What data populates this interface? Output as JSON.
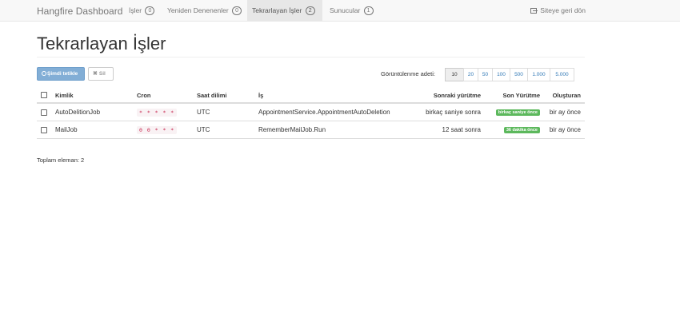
{
  "navbar": {
    "brand": "Hangfire Dashboard",
    "items": [
      {
        "label": "İşler",
        "count": "0"
      },
      {
        "label": "Yeniden Denenenler",
        "count": "0"
      },
      {
        "label": "Tekrarlayan İşler",
        "count": "2",
        "active": true
      },
      {
        "label": "Sunucular",
        "count": "1"
      }
    ],
    "back_label": "Siteye geri dön"
  },
  "page": {
    "title": "Tekrarlayan İşler"
  },
  "toolbar": {
    "trigger_label": "Şimdi tetikle",
    "delete_label": "Sil",
    "page_size_label": "Görüntülenme adeti:",
    "page_sizes": [
      "10",
      "20",
      "50",
      "100",
      "500",
      "1.000",
      "5.000"
    ],
    "selected_page_size": "10"
  },
  "table": {
    "columns": [
      "Kimlik",
      "Cron",
      "Saat dilimi",
      "İş",
      "Sonraki yürütme",
      "Son Yürütme",
      "Oluşturan"
    ],
    "rows": [
      {
        "id": "AutoDelitionJob",
        "cron": "* * * * *",
        "timezone": "UTC",
        "job": "AppointmentService.AppointmentAutoDeletion",
        "next": "birkaç saniye sonra",
        "last": "birkaç saniye önce",
        "created": "bir ay önce"
      },
      {
        "id": "MailJob",
        "cron": "0 0 * * *",
        "timezone": "UTC",
        "job": "RememberMailJob.Run",
        "next": "12 saat sonra",
        "last": "36 dakika önce",
        "created": "bir ay önce"
      }
    ]
  },
  "footer": {
    "total_label": "Toplam eleman: 2"
  },
  "colors": {
    "accent": "#337ab7",
    "success": "#5cb85c",
    "cron_text": "#c7254e"
  }
}
